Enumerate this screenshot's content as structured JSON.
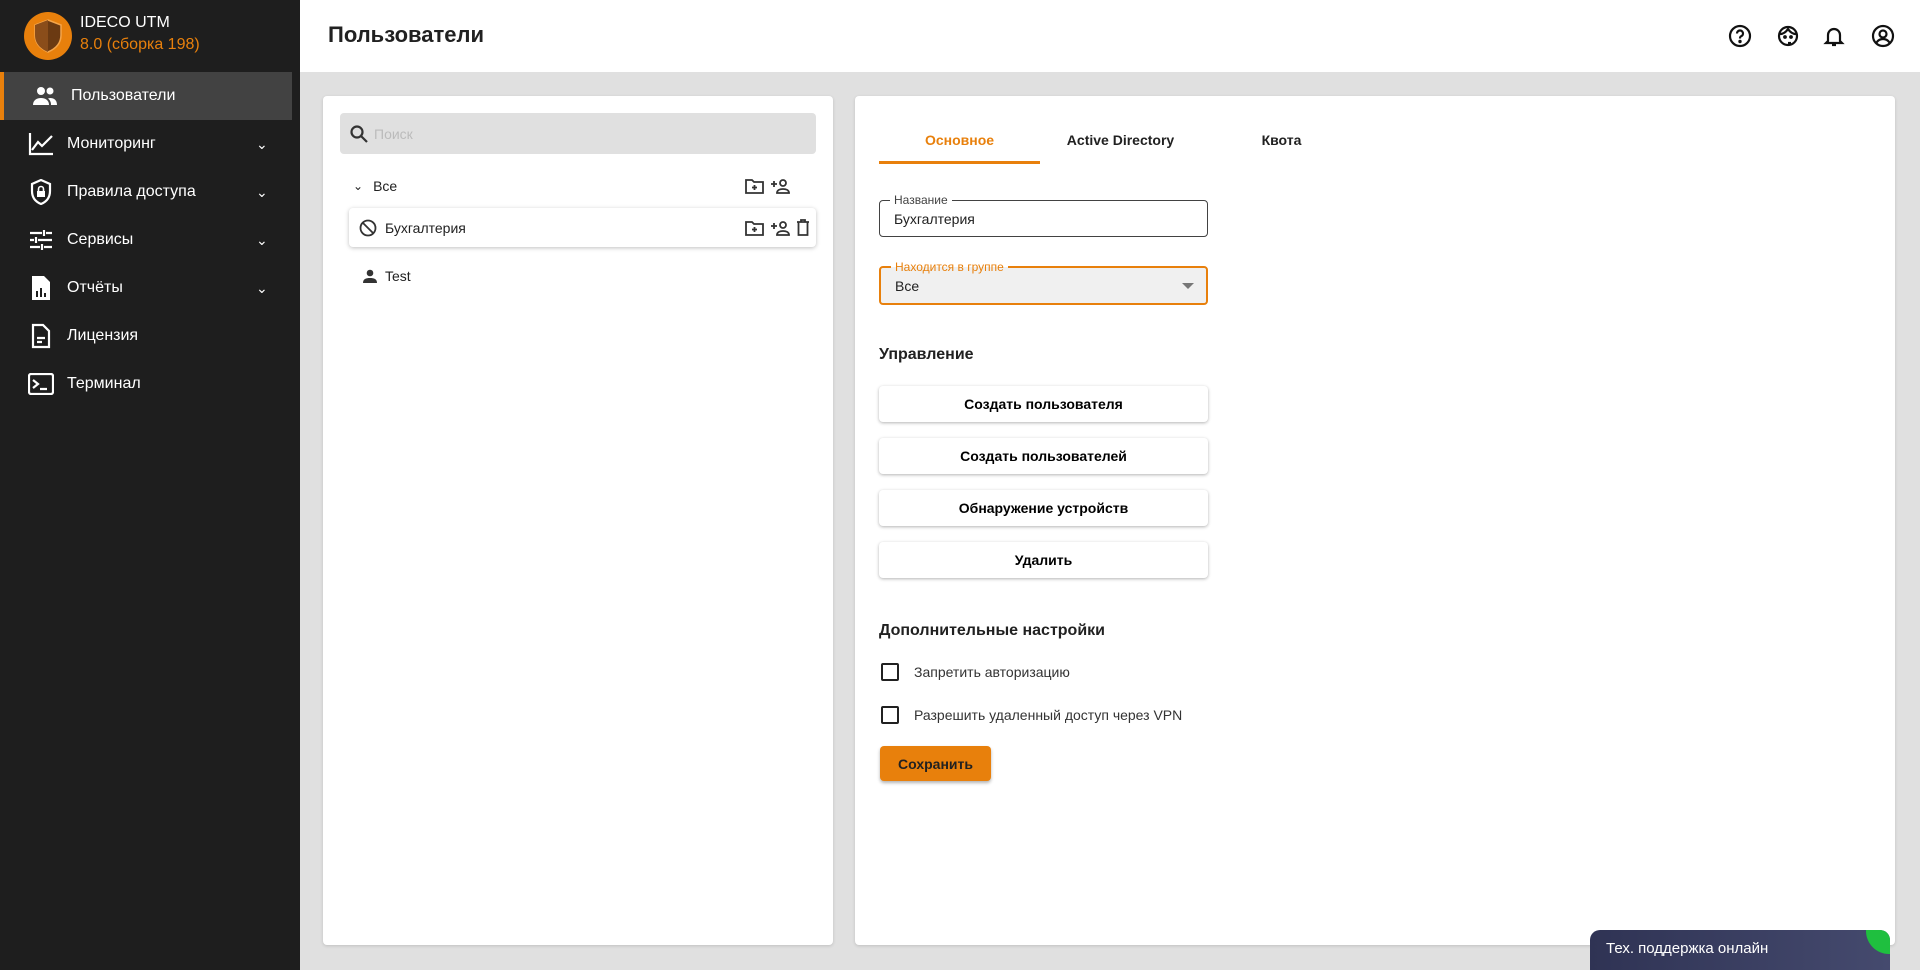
{
  "app": {
    "name": "IDECO UTM",
    "version": "8.0 (сборка 198)"
  },
  "sidebar": {
    "items": [
      {
        "label": "Пользователи",
        "icon": "users-icon",
        "active": true
      },
      {
        "label": "Мониторинг",
        "icon": "chart-line-icon",
        "expandable": true
      },
      {
        "label": "Правила доступа",
        "icon": "shield-lock-icon",
        "expandable": true
      },
      {
        "label": "Сервисы",
        "icon": "sliders-icon",
        "expandable": true
      },
      {
        "label": "Отчёты",
        "icon": "report-icon",
        "expandable": true
      },
      {
        "label": "Лицензия",
        "icon": "document-icon"
      },
      {
        "label": "Терминал",
        "icon": "terminal-icon"
      }
    ]
  },
  "header": {
    "title": "Пользователи"
  },
  "tree": {
    "search_placeholder": "Поиск",
    "root": "Все",
    "group": "Бухгалтерия",
    "user": "Test"
  },
  "tabs": [
    {
      "label": "Основное",
      "active": true
    },
    {
      "label": "Active Directory"
    },
    {
      "label": "Квота"
    }
  ],
  "form": {
    "name_label": "Название",
    "name_value": "Бухгалтерия",
    "group_label": "Находится в группе",
    "group_value": "Все",
    "management_title": "Управление",
    "buttons": [
      "Создать пользователя",
      "Создать пользователей",
      "Обнаружение устройств",
      "Удалить"
    ],
    "extra_title": "Дополнительные настройки",
    "checkboxes": [
      {
        "label": "Запретить авторизацию",
        "checked": false
      },
      {
        "label": "Разрешить удаленный доступ через VPN",
        "checked": false
      }
    ],
    "save": "Сохранить"
  },
  "support": {
    "label": "Тех. поддержка онлайн"
  },
  "colors": {
    "accent": "#e8800c",
    "sidebar": "#1e1e1e",
    "online": "#1fbf3f"
  }
}
